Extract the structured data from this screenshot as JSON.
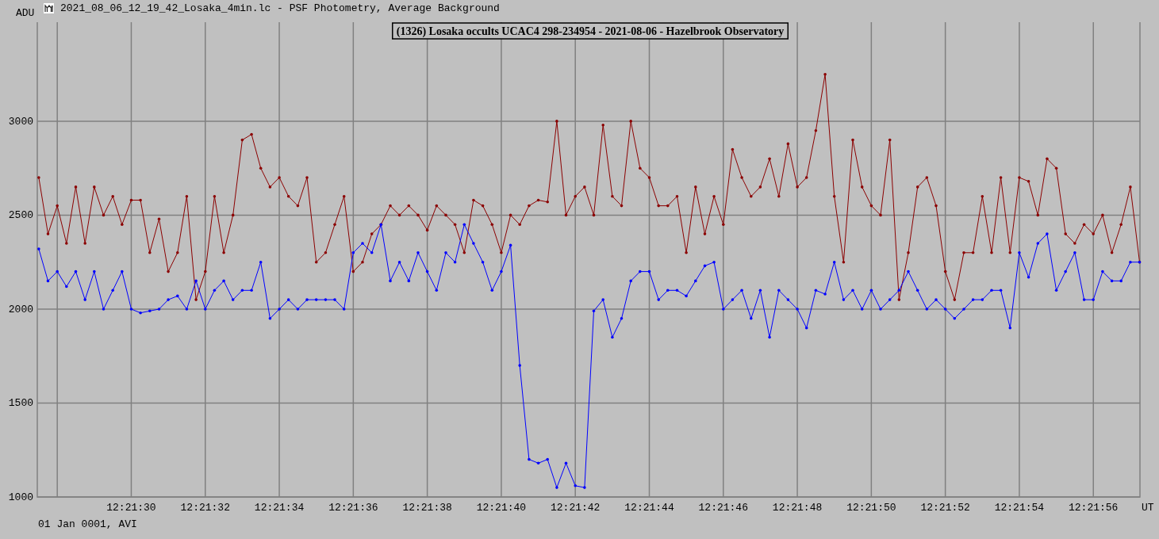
{
  "window": {
    "title": "2021_08_06_12_19_42_Losaka_4min.lc - PSF Photometry, Average Background"
  },
  "chart": {
    "chart_data": {
      "type": "line",
      "title": "(1326) Losaka occults UCAC4 298-234954 - 2021-08-06 - Hazelbrook Observatory",
      "xlabel": "UT",
      "ylabel": "ADU",
      "categories": [
        null,
        null,
        null,
        null,
        null,
        null,
        null,
        null,
        null,
        null,
        "12:21:30",
        null,
        null,
        null,
        null,
        null,
        null,
        null,
        "12:21:32",
        null,
        null,
        null,
        null,
        null,
        null,
        null,
        "12:21:34",
        null,
        null,
        null,
        null,
        null,
        null,
        null,
        "12:21:36",
        null,
        null,
        null,
        null,
        null,
        null,
        null,
        "12:21:38",
        null,
        null,
        null,
        null,
        null,
        null,
        null,
        "12:21:40",
        null,
        null,
        null,
        null,
        null,
        null,
        null,
        "12:21:42",
        null,
        null,
        null,
        null,
        null,
        null,
        null,
        "12:21:44",
        null,
        null,
        null,
        null,
        null,
        null,
        null,
        "12:21:46",
        null,
        null,
        null,
        null,
        null,
        null,
        null,
        "12:21:48",
        null,
        null,
        null,
        null,
        null,
        null,
        null,
        "12:21:50",
        null,
        null,
        null,
        null,
        null,
        null,
        null,
        "12:21:52",
        null,
        null,
        null,
        null,
        null,
        null,
        null,
        "12:21:54",
        null,
        null,
        null,
        null,
        null,
        null,
        null,
        "12:21:56",
        null,
        null,
        null,
        null,
        null
      ],
      "series": [
        {
          "color": "#8b0000",
          "values": [
            2700,
            2400,
            2550,
            2350,
            2650,
            2350,
            2650,
            2500,
            2600,
            2450,
            2580,
            2580,
            2300,
            2480,
            2200,
            2300,
            2600,
            2050,
            2200,
            2600,
            2300,
            2500,
            2900,
            2930,
            2750,
            2650,
            2700,
            2600,
            2550,
            2700,
            2250,
            2300,
            2450,
            2600,
            2200,
            2250,
            2400,
            2450,
            2550,
            2500,
            2550,
            2500,
            2420,
            2550,
            2500,
            2450,
            2300,
            2580,
            2550,
            2450,
            2300,
            2500,
            2450,
            2550,
            2580,
            2570,
            3000,
            2500,
            2600,
            2650,
            2500,
            2980,
            2600,
            2550,
            3000,
            2750,
            2700,
            2550,
            2550,
            2600,
            2300,
            2650,
            2400,
            2600,
            2450,
            2850,
            2700,
            2600,
            2650,
            2800,
            2600,
            2880,
            2650,
            2700,
            2950,
            3250,
            2600,
            2250,
            2900,
            2650,
            2550,
            2500,
            2900,
            2050,
            2300,
            2650,
            2700,
            2550,
            2200,
            2050,
            2300,
            2300,
            2600,
            2300,
            2700,
            2300,
            2700,
            2680,
            2500,
            2800,
            2750,
            2400,
            2350,
            2450,
            2400,
            2500,
            2300,
            2450,
            2650,
            2250
          ]
        },
        {
          "color": "#0000ff",
          "values": [
            2320,
            2150,
            2200,
            2120,
            2200,
            2050,
            2200,
            2000,
            2100,
            2200,
            2000,
            1980,
            1990,
            2000,
            2050,
            2070,
            2000,
            2150,
            2000,
            2100,
            2150,
            2050,
            2100,
            2100,
            2250,
            1950,
            2000,
            2050,
            2000,
            2050,
            2050,
            2050,
            2050,
            2000,
            2300,
            2350,
            2300,
            2450,
            2150,
            2250,
            2150,
            2300,
            2200,
            2100,
            2300,
            2250,
            2450,
            2350,
            2250,
            2100,
            2200,
            2340,
            1700,
            1200,
            1180,
            1200,
            1050,
            1180,
            1060,
            1050,
            1990,
            2050,
            1850,
            1950,
            2150,
            2200,
            2200,
            2050,
            2100,
            2100,
            2070,
            2150,
            2230,
            2250,
            2000,
            2050,
            2100,
            1950,
            2100,
            1850,
            2100,
            2050,
            2000,
            1900,
            2100,
            2080,
            2250,
            2050,
            2100,
            2000,
            2100,
            2000,
            2050,
            2100,
            2200,
            2100,
            2000,
            2050,
            2000,
            1950,
            2000,
            2050,
            2050,
            2100,
            2100,
            1900,
            2300,
            2170,
            2350,
            2400,
            2100,
            2200,
            2300,
            2050,
            2050,
            2200,
            2150,
            2150,
            2250,
            2250
          ]
        }
      ],
      "ylim": [
        1000,
        3527
      ],
      "grid": true,
      "yticks": [
        1000,
        1500,
        2000,
        2500,
        3000
      ]
    }
  },
  "footer": {
    "text": "01 Jan 0001, AVI"
  }
}
